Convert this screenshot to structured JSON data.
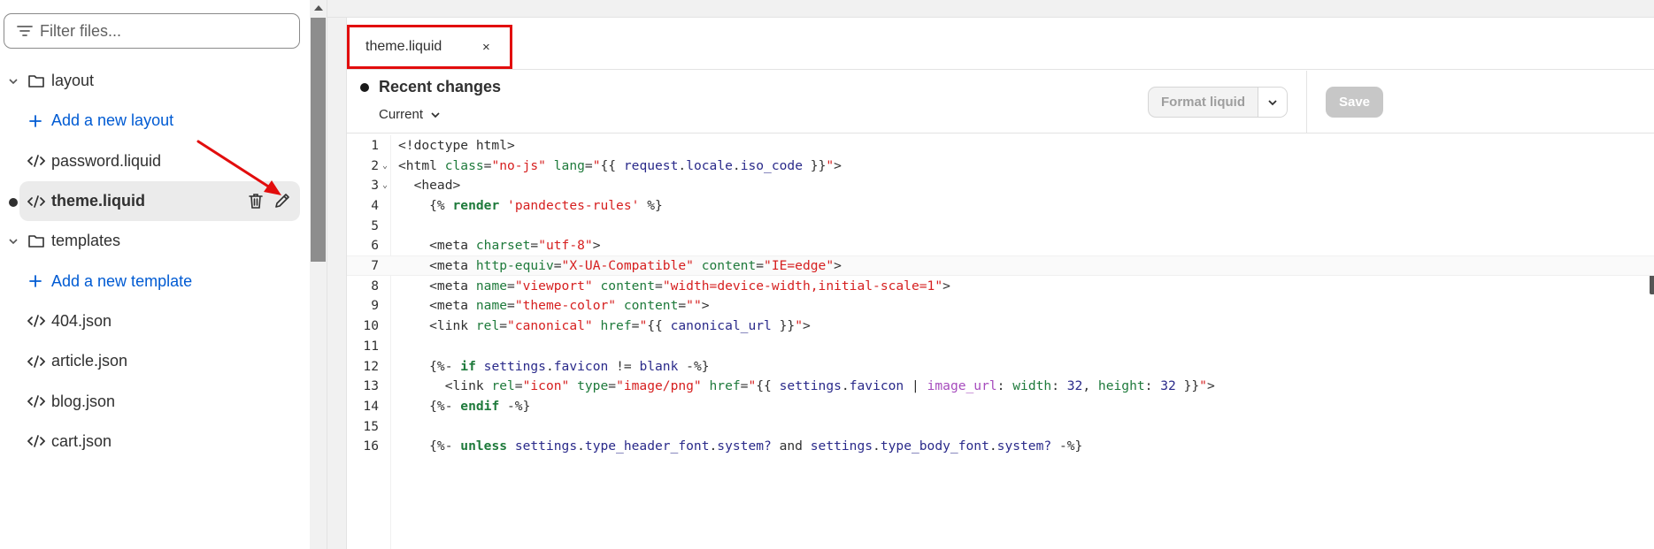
{
  "sidebar": {
    "filter_placeholder": "Filter files...",
    "items": [
      {
        "type": "folder",
        "label": "layout",
        "icon": "folder-icon"
      },
      {
        "type": "add",
        "label": "Add a new layout",
        "icon": "plus-icon"
      },
      {
        "type": "file",
        "label": "password.liquid",
        "icon": "code-icon"
      },
      {
        "type": "file",
        "label": "theme.liquid",
        "icon": "code-icon",
        "selected": true
      },
      {
        "type": "folder",
        "label": "templates",
        "icon": "folder-icon"
      },
      {
        "type": "add",
        "label": "Add a new template",
        "icon": "plus-icon"
      },
      {
        "type": "file",
        "label": "404.json",
        "icon": "code-icon"
      },
      {
        "type": "file",
        "label": "article.json",
        "icon": "code-icon"
      },
      {
        "type": "file",
        "label": "blog.json",
        "icon": "code-icon"
      },
      {
        "type": "file",
        "label": "cart.json",
        "icon": "code-icon"
      }
    ]
  },
  "editor": {
    "tab": {
      "label": "theme.liquid",
      "close": "×"
    },
    "recent_changes": "Recent changes",
    "version": "Current",
    "format_label": "Format liquid",
    "save_label": "Save",
    "highlighted_line": 7,
    "lines": [
      {
        "n": "1",
        "fold": false,
        "t": [
          [
            "t",
            "<!doctype html>"
          ]
        ]
      },
      {
        "n": "2",
        "fold": true,
        "t": [
          [
            "t",
            "<html "
          ],
          [
            "a",
            "class"
          ],
          [
            "t",
            "="
          ],
          [
            "s",
            "\"no-js\""
          ],
          [
            "t",
            " "
          ],
          [
            "a",
            "lang"
          ],
          [
            "t",
            "="
          ],
          [
            "s",
            "\""
          ],
          [
            "t",
            "{{ "
          ],
          [
            "v",
            "request"
          ],
          [
            "t",
            "."
          ],
          [
            "v",
            "locale"
          ],
          [
            "t",
            "."
          ],
          [
            "v",
            "iso_code"
          ],
          [
            "t",
            " }}"
          ],
          [
            "s",
            "\""
          ],
          [
            "t",
            ">"
          ]
        ]
      },
      {
        "n": "3",
        "fold": true,
        "t": [
          [
            "t",
            "  <head>"
          ]
        ]
      },
      {
        "n": "4",
        "fold": false,
        "t": [
          [
            "t",
            "    {% "
          ],
          [
            "k",
            "render"
          ],
          [
            "t",
            " "
          ],
          [
            "s",
            "'pandectes-rules'"
          ],
          [
            "t",
            " %}"
          ]
        ]
      },
      {
        "n": "5",
        "fold": false,
        "t": [
          [
            "t",
            ""
          ]
        ]
      },
      {
        "n": "6",
        "fold": false,
        "t": [
          [
            "t",
            "    <meta "
          ],
          [
            "a",
            "charset"
          ],
          [
            "t",
            "="
          ],
          [
            "s",
            "\"utf-8\""
          ],
          [
            "t",
            ">"
          ]
        ]
      },
      {
        "n": "7",
        "fold": false,
        "t": [
          [
            "t",
            "    <meta "
          ],
          [
            "a",
            "http-equiv"
          ],
          [
            "t",
            "="
          ],
          [
            "s",
            "\"X-UA-Compatible\""
          ],
          [
            "t",
            " "
          ],
          [
            "a",
            "content"
          ],
          [
            "t",
            "="
          ],
          [
            "s",
            "\"IE=edge\""
          ],
          [
            "t",
            ">"
          ]
        ]
      },
      {
        "n": "8",
        "fold": false,
        "t": [
          [
            "t",
            "    <meta "
          ],
          [
            "a",
            "name"
          ],
          [
            "t",
            "="
          ],
          [
            "s",
            "\"viewport\""
          ],
          [
            "t",
            " "
          ],
          [
            "a",
            "content"
          ],
          [
            "t",
            "="
          ],
          [
            "s",
            "\"width=device-width,initial-scale=1\""
          ],
          [
            "t",
            ">"
          ]
        ]
      },
      {
        "n": "9",
        "fold": false,
        "t": [
          [
            "t",
            "    <meta "
          ],
          [
            "a",
            "name"
          ],
          [
            "t",
            "="
          ],
          [
            "s",
            "\"theme-color\""
          ],
          [
            "t",
            " "
          ],
          [
            "a",
            "content"
          ],
          [
            "t",
            "="
          ],
          [
            "s",
            "\"\""
          ],
          [
            "t",
            ">"
          ]
        ]
      },
      {
        "n": "10",
        "fold": false,
        "t": [
          [
            "t",
            "    <link "
          ],
          [
            "a",
            "rel"
          ],
          [
            "t",
            "="
          ],
          [
            "s",
            "\"canonical\""
          ],
          [
            "t",
            " "
          ],
          [
            "a",
            "href"
          ],
          [
            "t",
            "="
          ],
          [
            "s",
            "\""
          ],
          [
            "t",
            "{{ "
          ],
          [
            "v",
            "canonical_url"
          ],
          [
            "t",
            " }}"
          ],
          [
            "s",
            "\""
          ],
          [
            "t",
            ">"
          ]
        ]
      },
      {
        "n": "11",
        "fold": false,
        "t": [
          [
            "t",
            ""
          ]
        ]
      },
      {
        "n": "12",
        "fold": false,
        "t": [
          [
            "t",
            "    {%- "
          ],
          [
            "k",
            "if"
          ],
          [
            "t",
            " "
          ],
          [
            "v",
            "settings"
          ],
          [
            "t",
            "."
          ],
          [
            "v",
            "favicon"
          ],
          [
            "t",
            " != "
          ],
          [
            "v",
            "blank"
          ],
          [
            "t",
            " -%}"
          ]
        ]
      },
      {
        "n": "13",
        "fold": false,
        "t": [
          [
            "t",
            "      <link "
          ],
          [
            "a",
            "rel"
          ],
          [
            "t",
            "="
          ],
          [
            "s",
            "\"icon\""
          ],
          [
            "t",
            " "
          ],
          [
            "a",
            "type"
          ],
          [
            "t",
            "="
          ],
          [
            "s",
            "\"image/png\""
          ],
          [
            "t",
            " "
          ],
          [
            "a",
            "href"
          ],
          [
            "t",
            "="
          ],
          [
            "s",
            "\""
          ],
          [
            "t",
            "{{ "
          ],
          [
            "v",
            "settings"
          ],
          [
            "t",
            "."
          ],
          [
            "v",
            "favicon"
          ],
          [
            "t",
            " | "
          ],
          [
            "f",
            "image_url"
          ],
          [
            "t",
            ": "
          ],
          [
            "a",
            "width"
          ],
          [
            "t",
            ": "
          ],
          [
            "n",
            "32"
          ],
          [
            "t",
            ", "
          ],
          [
            "a",
            "height"
          ],
          [
            "t",
            ": "
          ],
          [
            "n",
            "32"
          ],
          [
            "t",
            " }}"
          ],
          [
            "s",
            "\""
          ],
          [
            "t",
            ">"
          ]
        ]
      },
      {
        "n": "14",
        "fold": false,
        "t": [
          [
            "t",
            "    {%- "
          ],
          [
            "k",
            "endif"
          ],
          [
            "t",
            " -%}"
          ]
        ]
      },
      {
        "n": "15",
        "fold": false,
        "t": [
          [
            "t",
            ""
          ]
        ]
      },
      {
        "n": "16",
        "fold": false,
        "t": [
          [
            "t",
            "    {%- "
          ],
          [
            "k",
            "unless"
          ],
          [
            "t",
            " "
          ],
          [
            "v",
            "settings"
          ],
          [
            "t",
            "."
          ],
          [
            "v",
            "type_header_font"
          ],
          [
            "t",
            "."
          ],
          [
            "v",
            "system?"
          ],
          [
            "t",
            " and "
          ],
          [
            "v",
            "settings"
          ],
          [
            "t",
            "."
          ],
          [
            "v",
            "type_body_font"
          ],
          [
            "t",
            "."
          ],
          [
            "v",
            "system?"
          ],
          [
            "t",
            " -%}"
          ]
        ]
      }
    ]
  },
  "colors": {
    "accent_link": "#005bd3",
    "annotation_red": "#e20d0d"
  }
}
